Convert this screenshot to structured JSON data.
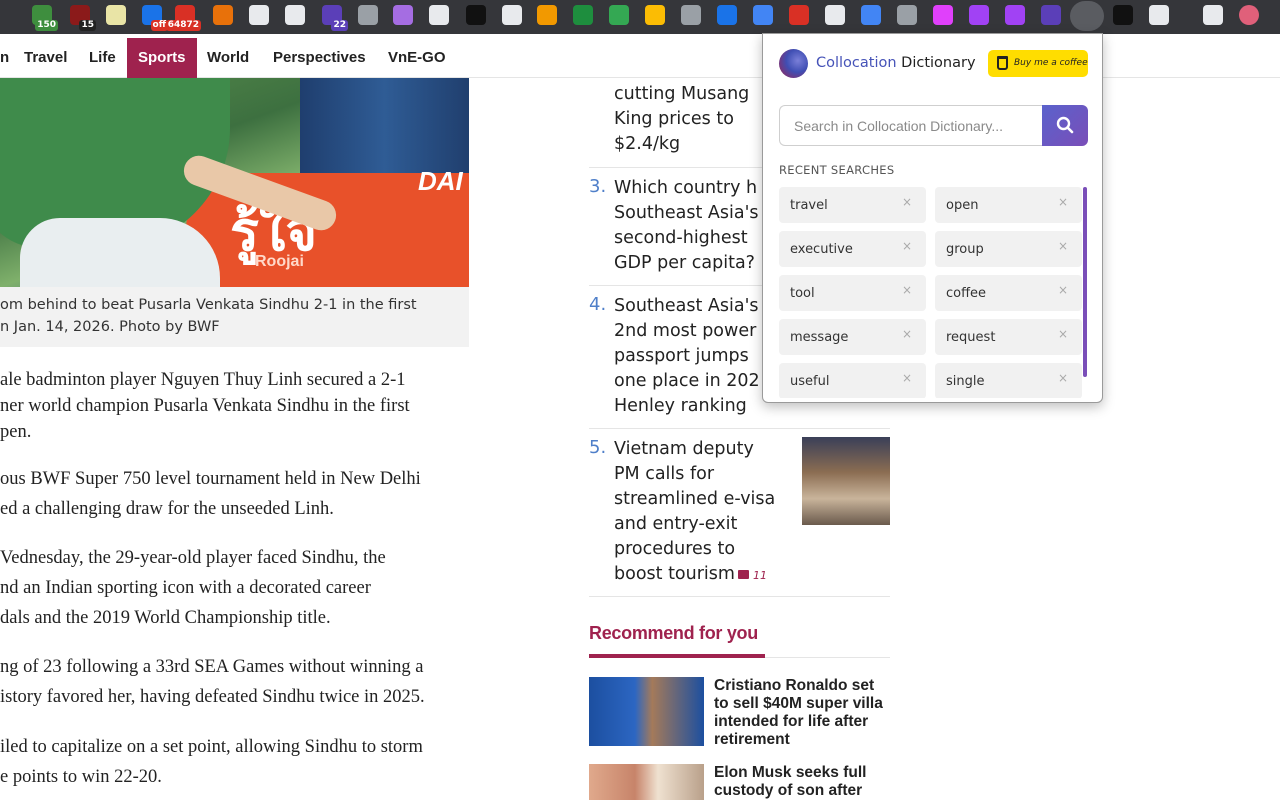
{
  "toolbar": {
    "extensions": [
      {
        "icon": "extension-green-icon",
        "color": "#3e8e3e",
        "badge": "150",
        "badge_color": "#3e8e3e"
      },
      {
        "icon": "extension-book-icon",
        "color": "#8b1a1a",
        "badge": "15",
        "badge_color": "#222222"
      },
      {
        "icon": "extension-note-icon",
        "color": "#e9e4a6",
        "badge": "",
        "badge_color": ""
      },
      {
        "icon": "extension-tag-icon",
        "color": "#1a73e8",
        "badge": "off",
        "badge_color": "#d93025"
      },
      {
        "icon": "extension-mail-icon",
        "color": "#d93025",
        "badge": "64872",
        "badge_color": "#d93025"
      },
      {
        "icon": "extension-circle-icon",
        "color": "#e8710a",
        "badge": "",
        "badge_color": ""
      },
      {
        "icon": "extension-g-icon",
        "color": "#e8eaed",
        "badge": "",
        "badge_color": ""
      },
      {
        "icon": "extension-react-icon",
        "color": "#e8eaed",
        "badge": "",
        "badge_color": ""
      },
      {
        "icon": "extension-hat-icon",
        "color": "#5b3fb8",
        "badge": "22",
        "badge_color": "#5b3fb8"
      },
      {
        "icon": "extension-wp-icon",
        "color": "#9aa0a6",
        "badge": "",
        "badge_color": ""
      },
      {
        "icon": "extension-gear-icon",
        "color": "#a56de2",
        "badge": "",
        "badge_color": ""
      },
      {
        "icon": "extension-swirl-icon",
        "color": "#e8eaed",
        "badge": "",
        "badge_color": ""
      },
      {
        "icon": "extension-pen-icon",
        "color": "#111111",
        "badge": "",
        "badge_color": ""
      },
      {
        "icon": "extension-ruler-icon",
        "color": "#e8eaed",
        "badge": "",
        "badge_color": ""
      },
      {
        "icon": "extension-tiger-icon",
        "color": "#f29900",
        "badge": "",
        "badge_color": ""
      },
      {
        "icon": "extension-slash-icon",
        "color": "#1e8e3e",
        "badge": "",
        "badge_color": ""
      },
      {
        "icon": "extension-bulb-icon",
        "color": "#34a853",
        "badge": "",
        "badge_color": ""
      },
      {
        "icon": "extension-sticky-icon",
        "color": "#fbbc04",
        "badge": "",
        "badge_color": ""
      },
      {
        "icon": "extension-image-icon",
        "color": "#9aa0a6",
        "badge": "",
        "badge_color": ""
      },
      {
        "icon": "extension-shield-icon",
        "color": "#1a73e8",
        "badge": "",
        "badge_color": ""
      },
      {
        "icon": "extension-save-icon",
        "color": "#4285f4",
        "badge": "",
        "badge_color": ""
      },
      {
        "icon": "extension-cross-icon",
        "color": "#d93025",
        "badge": "",
        "badge_color": ""
      },
      {
        "icon": "extension-info-icon",
        "color": "#e8eaed",
        "badge": "",
        "badge_color": ""
      },
      {
        "icon": "extension-doc-icon",
        "color": "#4285f4",
        "badge": "",
        "badge_color": ""
      },
      {
        "icon": "extension-camera-icon",
        "color": "#9aa0a6",
        "badge": "",
        "badge_color": ""
      },
      {
        "icon": "extension-video-icon",
        "color": "#e040fb",
        "badge": "",
        "badge_color": ""
      },
      {
        "icon": "extension-heart-icon",
        "color": "#a142f4",
        "badge": "",
        "badge_color": ""
      },
      {
        "icon": "extension-paren-icon",
        "color": "#a142f4",
        "badge": "",
        "badge_color": ""
      },
      {
        "icon": "extension-link-icon",
        "color": "#5b3fb8",
        "badge": "",
        "badge_color": ""
      },
      {
        "icon": "collocation-dictionary-icon",
        "color": "#3f4eb3",
        "badge": "",
        "badge_color": ""
      },
      {
        "icon": "extension-yg-icon",
        "color": "#111111",
        "badge": "",
        "badge_color": ""
      },
      {
        "icon": "extensions-puzzle-icon",
        "color": "#e8eaed",
        "badge": "",
        "badge_color": ""
      },
      {
        "icon": "reading-list-icon",
        "color": "#e8eaed",
        "badge": "",
        "badge_color": ""
      },
      {
        "icon": "profile-avatar-icon",
        "color": "#e0607a",
        "badge": "",
        "badge_color": ""
      }
    ]
  },
  "nav": {
    "items": [
      "n",
      "Travel",
      "Life",
      "Sports",
      "World",
      "Perspectives",
      "VnE-GO"
    ],
    "active": "Sports"
  },
  "article": {
    "photo_text": "รู้ใจ",
    "photo_sub": "Roojai",
    "photo_side": "DAI",
    "caption_lines": [
      "om behind to beat Pusarla Venkata Sindhu 2-1 in the first",
      "n Jan. 14, 2026. Photo by BWF"
    ],
    "paragraphs": [
      [
        "ale badminton player Nguyen Thuy Linh secured a 2-1",
        "ner world champion Pusarla Venkata Sindhu in the first",
        "pen."
      ],
      [
        "ous BWF Super 750 level tournament held in New Delhi",
        "ed a challenging draw for the unseeded Linh."
      ],
      [
        "Vednesday, the 29-year-old player faced Sindhu, the",
        "nd an Indian sporting icon with a decorated career",
        "dals and the 2019 World Championship title."
      ],
      [
        "ng of 23 following a 33rd SEA Games without winning a",
        "istory favored her, having defeated Sindhu twice in 2025."
      ],
      [
        "iled to capitalize on a set point, allowing Sindhu to storm",
        "e points to win 22-20."
      ]
    ]
  },
  "sidebar": {
    "ranked": [
      {
        "num": "",
        "title": "cutting Musang\nKing prices to\n$2.4/kg",
        "comments": ""
      },
      {
        "num": "3.",
        "title": "Which country h\nSoutheast Asia's\nsecond-highest\nGDP per capita?",
        "comments": ""
      },
      {
        "num": "4.",
        "title": "Southeast Asia's\n2nd most power\npassport jumps\none place in 202\nHenley ranking",
        "comments": ""
      },
      {
        "num": "5.",
        "title": "Vietnam deputy\nPM calls for\nstreamlined e-visa\nand entry-exit\nprocedures to\nboost tourism",
        "comments": "11"
      }
    ],
    "recommend_heading": "Recommend for you",
    "recommend": [
      {
        "title": "Cristiano Ronaldo set to sell $40M super villa intended for life after retirement"
      },
      {
        "title": "Elon Musk seeks full custody of son after"
      }
    ]
  },
  "popup": {
    "brand_first": "Collocation",
    "brand_second": "Dictionary",
    "bmc_label": "Buy me a coffee",
    "search_placeholder": "Search in Collocation Dictionary...",
    "recent_label": "RECENT SEARCHES",
    "recent": [
      "travel",
      "open",
      "executive",
      "group",
      "tool",
      "coffee",
      "message",
      "request",
      "useful",
      "single"
    ]
  }
}
